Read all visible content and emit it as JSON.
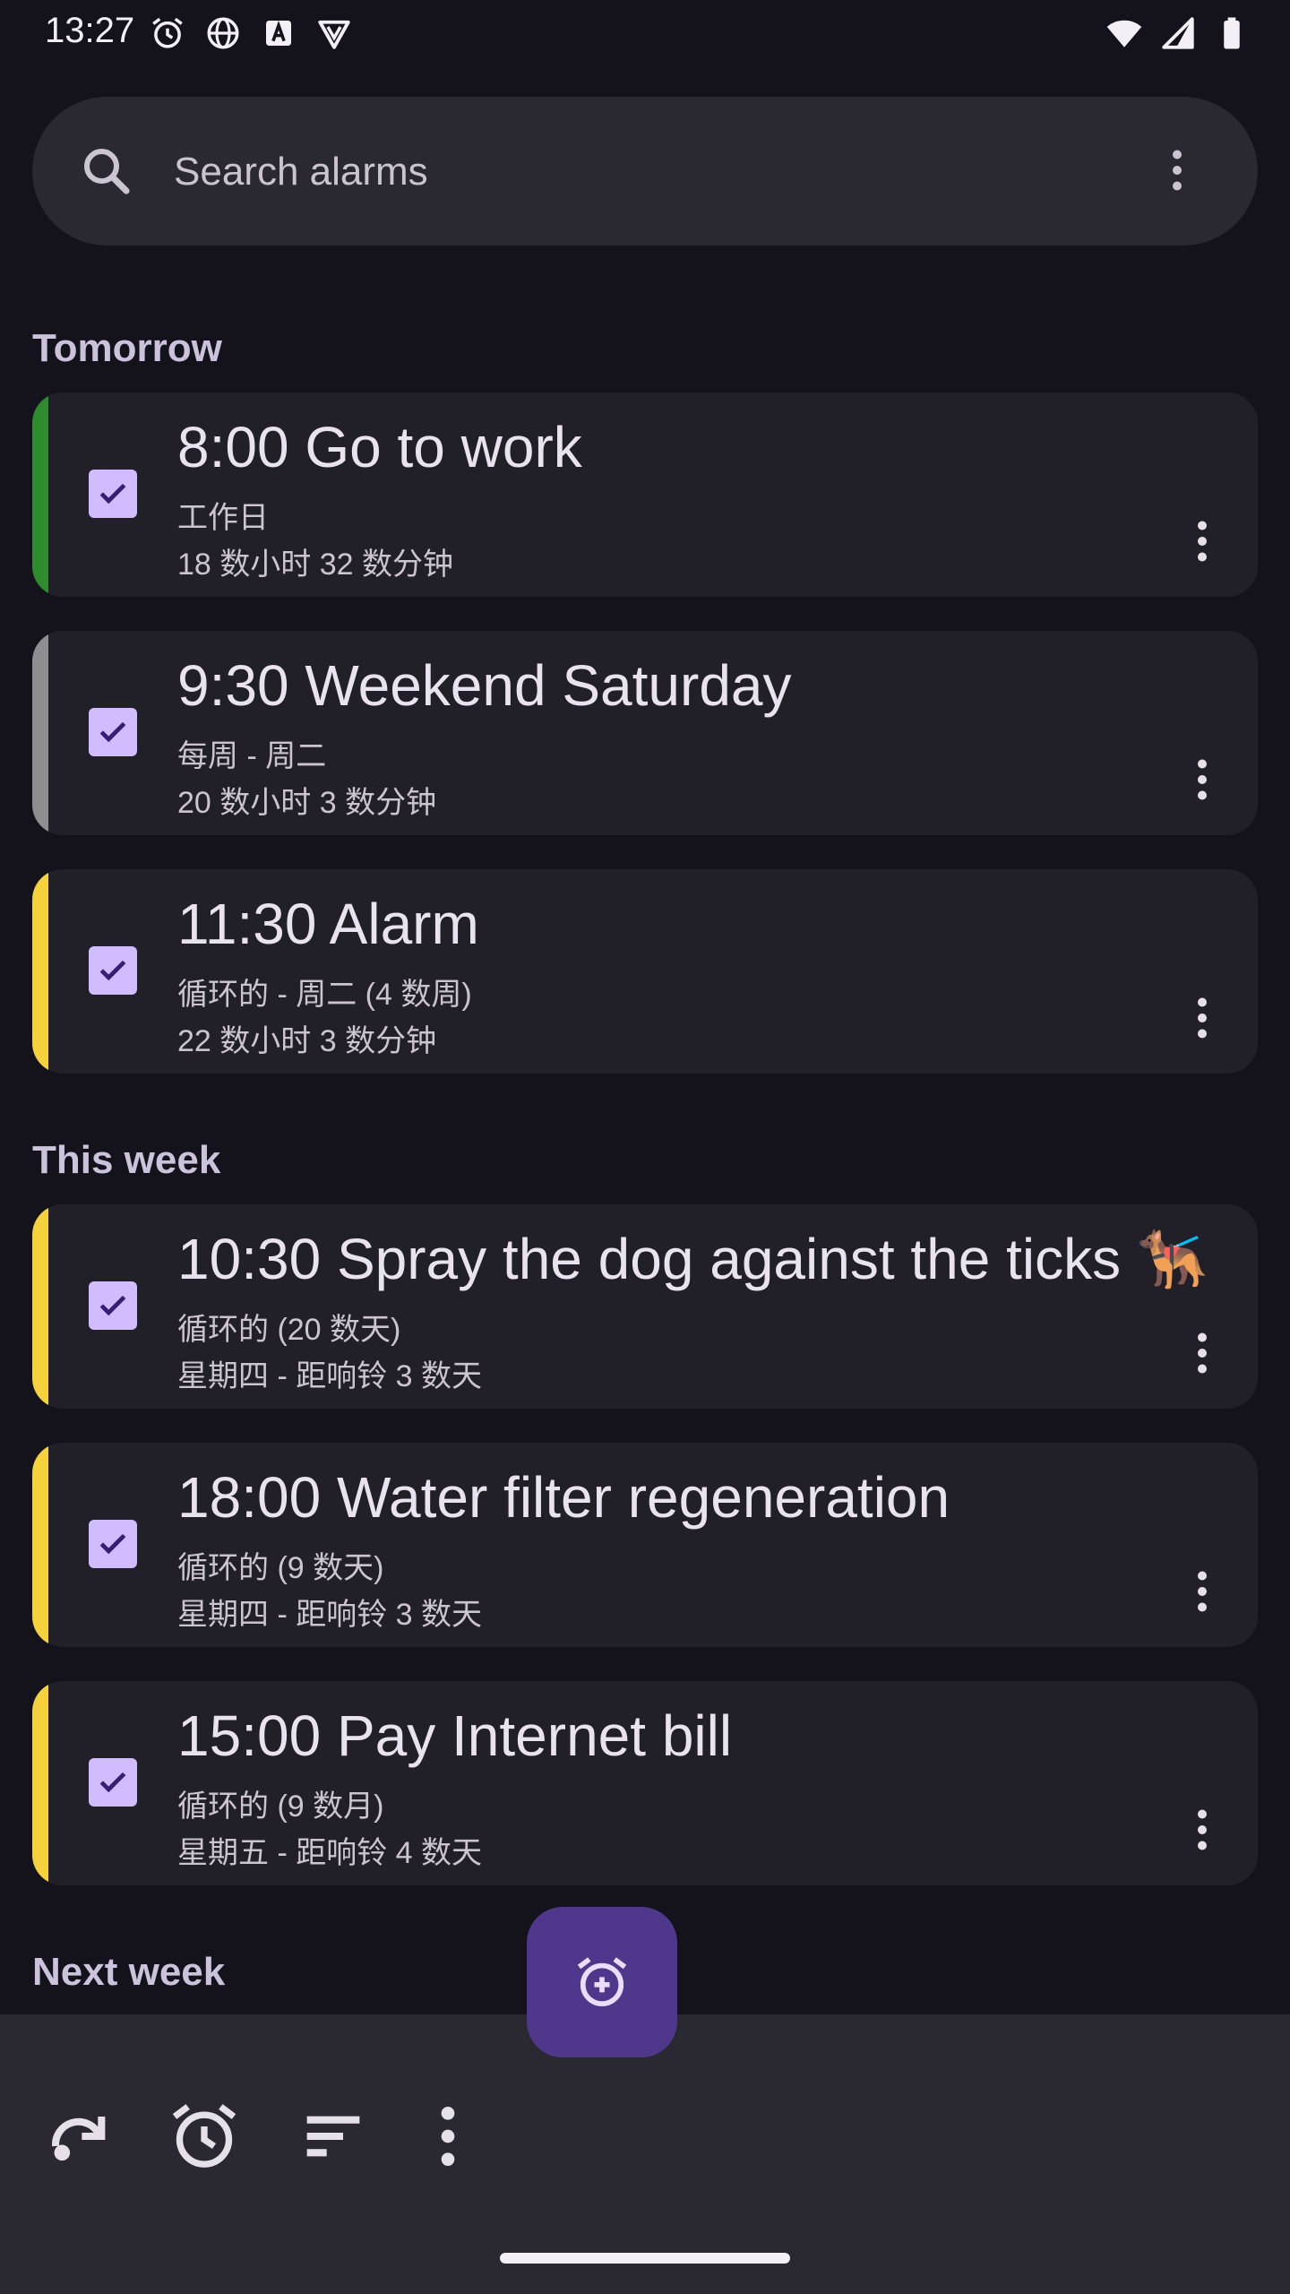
{
  "status_bar": {
    "time": "13:27",
    "left_icons": [
      "alarm-icon",
      "globe-icon",
      "font-a-icon",
      "shield-v-icon"
    ],
    "right_icons": [
      "wifi-icon",
      "signal-icon",
      "battery-icon"
    ]
  },
  "search": {
    "placeholder": "Search alarms",
    "icon": "search-icon",
    "more_icon": "more-vert-icon"
  },
  "sections": [
    {
      "label": "Tomorrow",
      "alarms": [
        {
          "title": "8:00 Go to work",
          "line1": "工作日",
          "line2": "18 数小时 32 数分钟",
          "color": "#2e8b2e"
        },
        {
          "title": "9:30 Weekend Saturday",
          "line1": "每周 - 周二",
          "line2": "20 数小时 3 数分钟",
          "color": "#8e8e8e"
        },
        {
          "title": "11:30 Alarm",
          "line1": "循环的 - 周二 (4 数周)",
          "line2": "22 数小时 3 数分钟",
          "color": "#f5d23b"
        }
      ]
    },
    {
      "label": "This week",
      "alarms": [
        {
          "title": "10:30 Spray the dog against the ticks 🐕‍🦺",
          "line1": "循环的 (20 数天)",
          "line2": "星期四 - 距响铃 3 数天",
          "color": "#f5d23b"
        },
        {
          "title": "18:00 Water filter regeneration",
          "line1": "循环的 (9 数天)",
          "line2": "星期四 - 距响铃 3 数天",
          "color": "#f5d23b"
        },
        {
          "title": "15:00 Pay Internet bill",
          "line1": "循环的 (9 数月)",
          "line2": "星期五 - 距响铃 4 数天",
          "color": "#f5d23b"
        }
      ]
    },
    {
      "label": "Next week",
      "alarms": []
    }
  ],
  "bottom_bar": {
    "buttons": [
      "skip-redo-icon",
      "alarm-clock-icon",
      "sort-icon",
      "more-vert-icon"
    ]
  },
  "fab": {
    "icon": "alarm-add-icon"
  },
  "colors": {
    "background": "#14121b",
    "surface": "#211f27",
    "accent": "#d0bcff",
    "fab": "#4f378b"
  }
}
